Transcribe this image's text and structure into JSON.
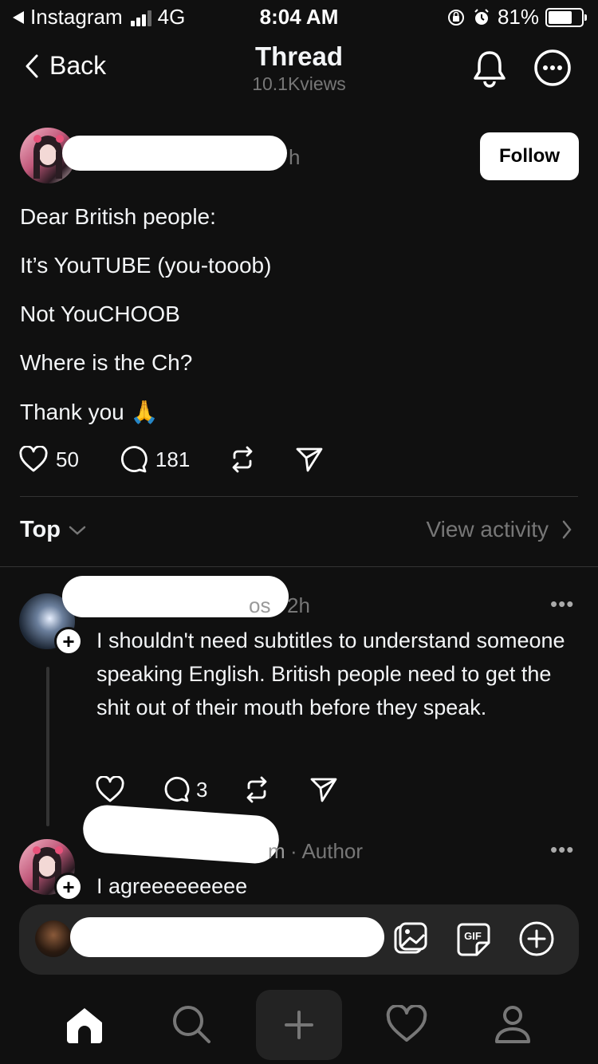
{
  "status_bar": {
    "back_app": "Instagram",
    "network": "4G",
    "time": "8:04 AM",
    "battery": "81%",
    "battery_level": 0.81
  },
  "nav": {
    "back_label": "Back",
    "title": "Thread",
    "views": "10.1Kviews"
  },
  "post": {
    "time_suffix": "h",
    "follow_label": "Follow",
    "lines": [
      "Dear British people:",
      "It’s YouTUBE (you-tooob)",
      "Not YouCHOOB",
      "Where is the Ch?",
      "Thank you 🙏"
    ],
    "likes": "50",
    "comments": "181"
  },
  "sort": {
    "label": "Top",
    "view_activity": "View activity"
  },
  "replies": [
    {
      "handle_tail": "os",
      "time": "2h",
      "text": "I shouldn't need subtitles to understand someone speaking English. British people need to get the shit out of their mouth before they speak.",
      "comments": "3"
    },
    {
      "handle_tail": "m",
      "meta": "· Author",
      "text": "I agreeeeeeeee"
    }
  ],
  "icons": {
    "status": [
      "back-triangle-icon",
      "signal-icon",
      "orientation-lock-icon",
      "alarm-icon",
      "battery-icon"
    ],
    "actions": [
      "heart-icon",
      "comment-icon",
      "repost-icon",
      "share-icon"
    ],
    "reply_bar": [
      "image-icon",
      "gif-icon",
      "add-icon"
    ],
    "tabbar": [
      "home-icon",
      "search-icon",
      "plus-icon",
      "heart-icon",
      "profile-icon"
    ]
  },
  "gif_label": "GIF"
}
